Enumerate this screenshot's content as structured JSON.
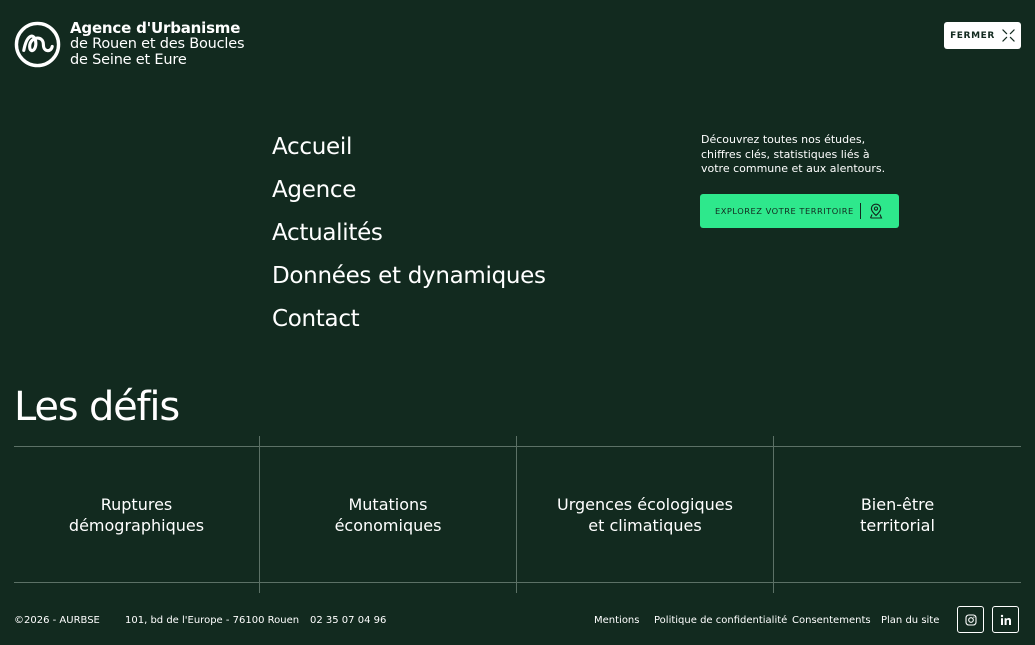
{
  "header": {
    "logo_title": "Agence d'Urbanisme",
    "logo_line2": "de Rouen et des Boucles",
    "logo_line3": "de Seine et Eure",
    "close_label": "FERMER"
  },
  "nav": {
    "items": [
      "Accueil",
      "Agence",
      "Actualités",
      "Données et dynamiques",
      "Contact"
    ]
  },
  "explore": {
    "text": "Découvrez toutes nos études, chiffres clés, statistiques liés à votre commune et aux alentours.",
    "button_label": "EXPLOREZ VOTRE TERRITOIRE",
    "icon": "map-pin-icon"
  },
  "defis": {
    "title": "Les défis",
    "cards": [
      {
        "line1": "Ruptures",
        "line2": "démographiques"
      },
      {
        "line1": "Mutations",
        "line2": "économiques"
      },
      {
        "line1": "Urgences écologiques",
        "line2": "et climatiques"
      },
      {
        "line1": "Bien-être",
        "line2": "territorial"
      }
    ]
  },
  "footer": {
    "copyright": "©2026 - AURBSE",
    "address": "101, bd de l'Europe - 76100 Rouen",
    "phone": "02 35 07 04 96",
    "links": [
      "Mentions",
      "Politique de confidentialité",
      "Consentements",
      "Plan du site"
    ],
    "social": [
      "instagram-icon",
      "linkedin-icon"
    ]
  },
  "colors": {
    "background": "#122a1f",
    "accent": "#2ee88c",
    "text": "#ffffff"
  }
}
